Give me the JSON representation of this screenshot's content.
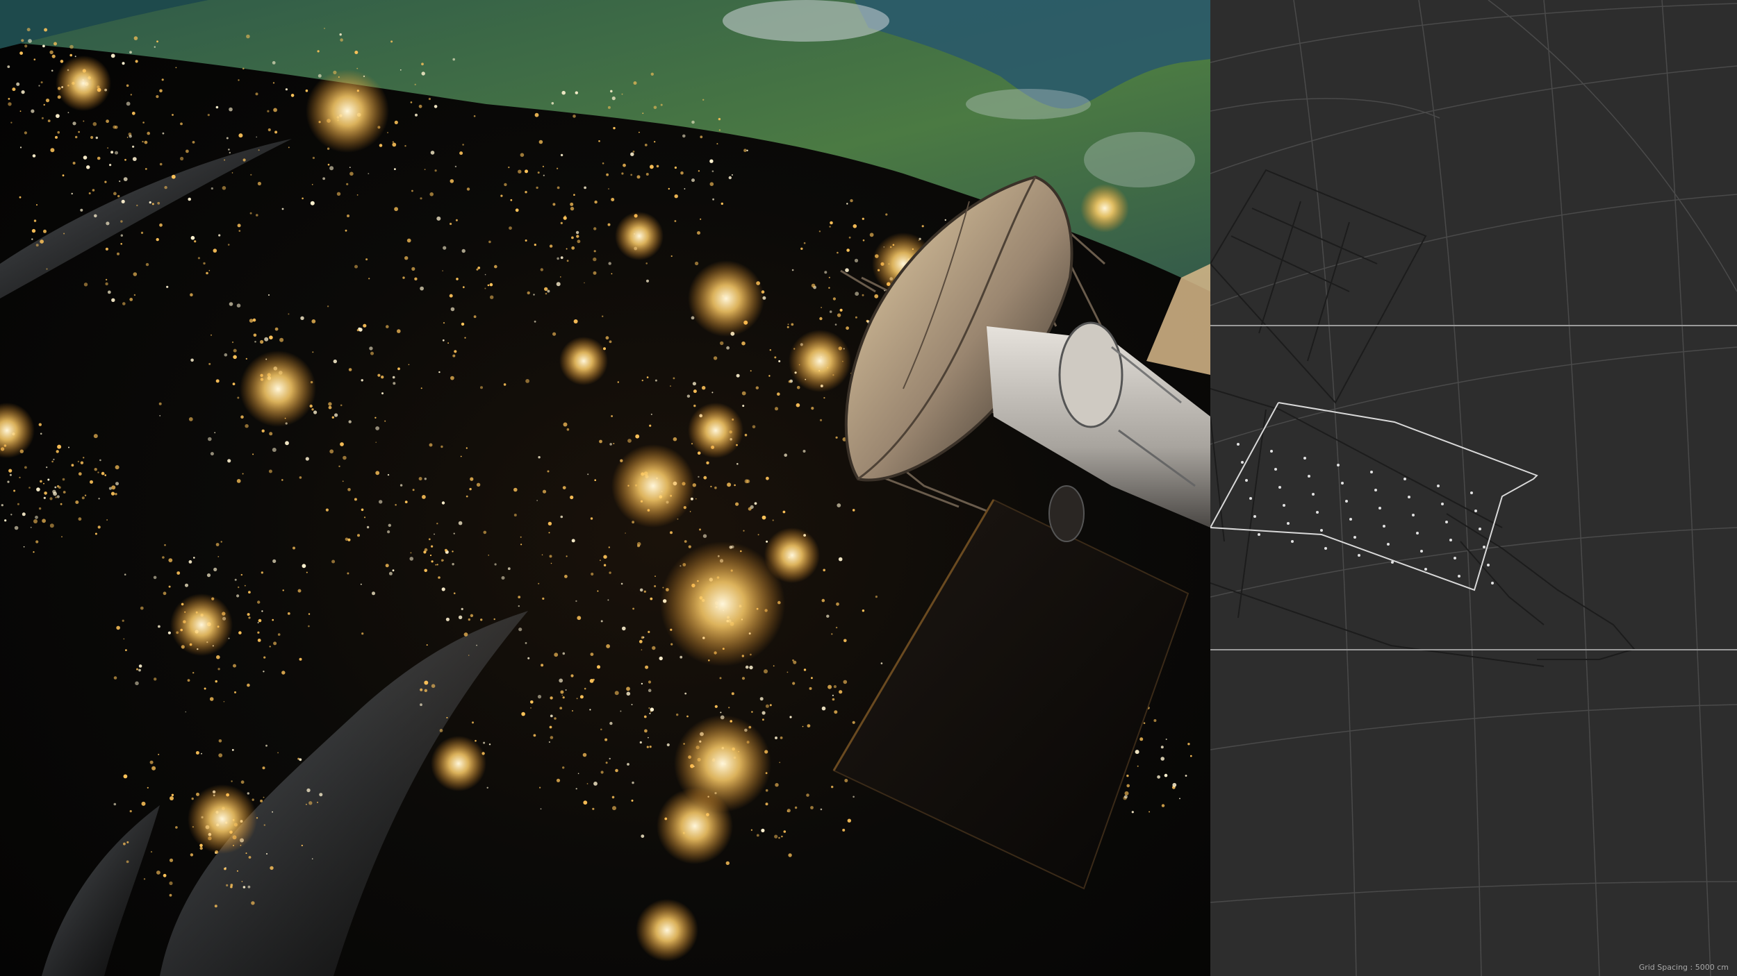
{
  "viewports": {
    "render": {
      "name": "rendered-view",
      "content": "satellite-over-earth-at-night"
    },
    "wireframe": {
      "name": "wireframe-view",
      "grid_spacing_label": "Grid Spacing : 5000 cm"
    }
  },
  "colors": {
    "city_light": "#ffc45a",
    "city_core": "#fff3d0",
    "ocean": "#1e4a4c",
    "land": "#3d6a3a",
    "wire_bg": "#2d2d2d",
    "wire_line": "#5a5a5a",
    "wire_highlight": "#d0d0d0"
  }
}
